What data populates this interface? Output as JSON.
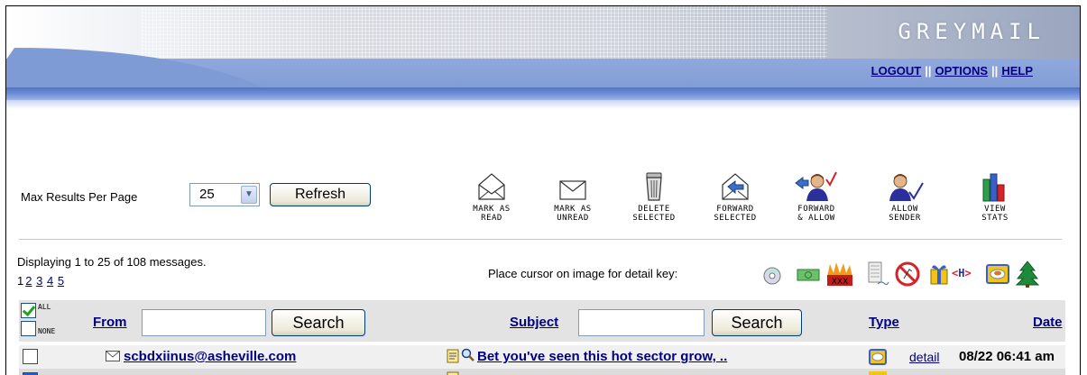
{
  "brand": "GREYMAIL",
  "top_links": {
    "logout": "LOGOUT",
    "options": "OPTIONS",
    "help": "HELP",
    "separator": "||"
  },
  "toolbar": {
    "max_results_label": "Max Results Per Page",
    "max_results_value": "25",
    "refresh_label": "Refresh",
    "actions": [
      {
        "label": "MARK AS\nREAD",
        "icon": "open-envelope-icon"
      },
      {
        "label": "MARK AS\nUNREAD",
        "icon": "closed-envelope-icon"
      },
      {
        "label": "DELETE\nSELECTED",
        "icon": "trash-can-icon"
      },
      {
        "label": "FORWARD\nSELECTED",
        "icon": "forward-envelope-icon"
      },
      {
        "label": "FORWARD\n& ALLOW",
        "icon": "forward-allow-person-icon"
      },
      {
        "label": "ALLOW\nSENDER",
        "icon": "allow-sender-person-icon"
      },
      {
        "label": "VIEW\nSTATS",
        "icon": "bar-chart-icon"
      }
    ]
  },
  "info": {
    "displaying": "Displaying 1 to 25 of 108 messages.",
    "current_page": "1",
    "pages": [
      "2",
      "3",
      "4",
      "5"
    ],
    "key_text": "Place cursor on image for detail key:",
    "key_icons": [
      "cd-icon",
      "money-icon",
      "xxx-fire-icon",
      "document-icon",
      "no-symbol-icon",
      "gift-icon",
      "html-tag-icon",
      "food-plate-icon",
      "tree-icon"
    ]
  },
  "table": {
    "all_label": "ALL",
    "none_label": "NONE",
    "from_label": "From",
    "from_search_value": "",
    "search_label": "Search",
    "subject_label": "Subject",
    "subject_search_value": "",
    "type_label": "Type",
    "date_label": "Date"
  },
  "rows": [
    {
      "from": "scbdxiinus@asheville.com",
      "subject": "Bet you've seen this hot sector grow, ..",
      "detail": "detail",
      "date": "08/22 06:41 am"
    }
  ],
  "colors": {
    "link": "#000080",
    "header_blue": "#7f9bd6",
    "row_alt": "#f0f0f0",
    "table_header": "#e3e3e3"
  }
}
